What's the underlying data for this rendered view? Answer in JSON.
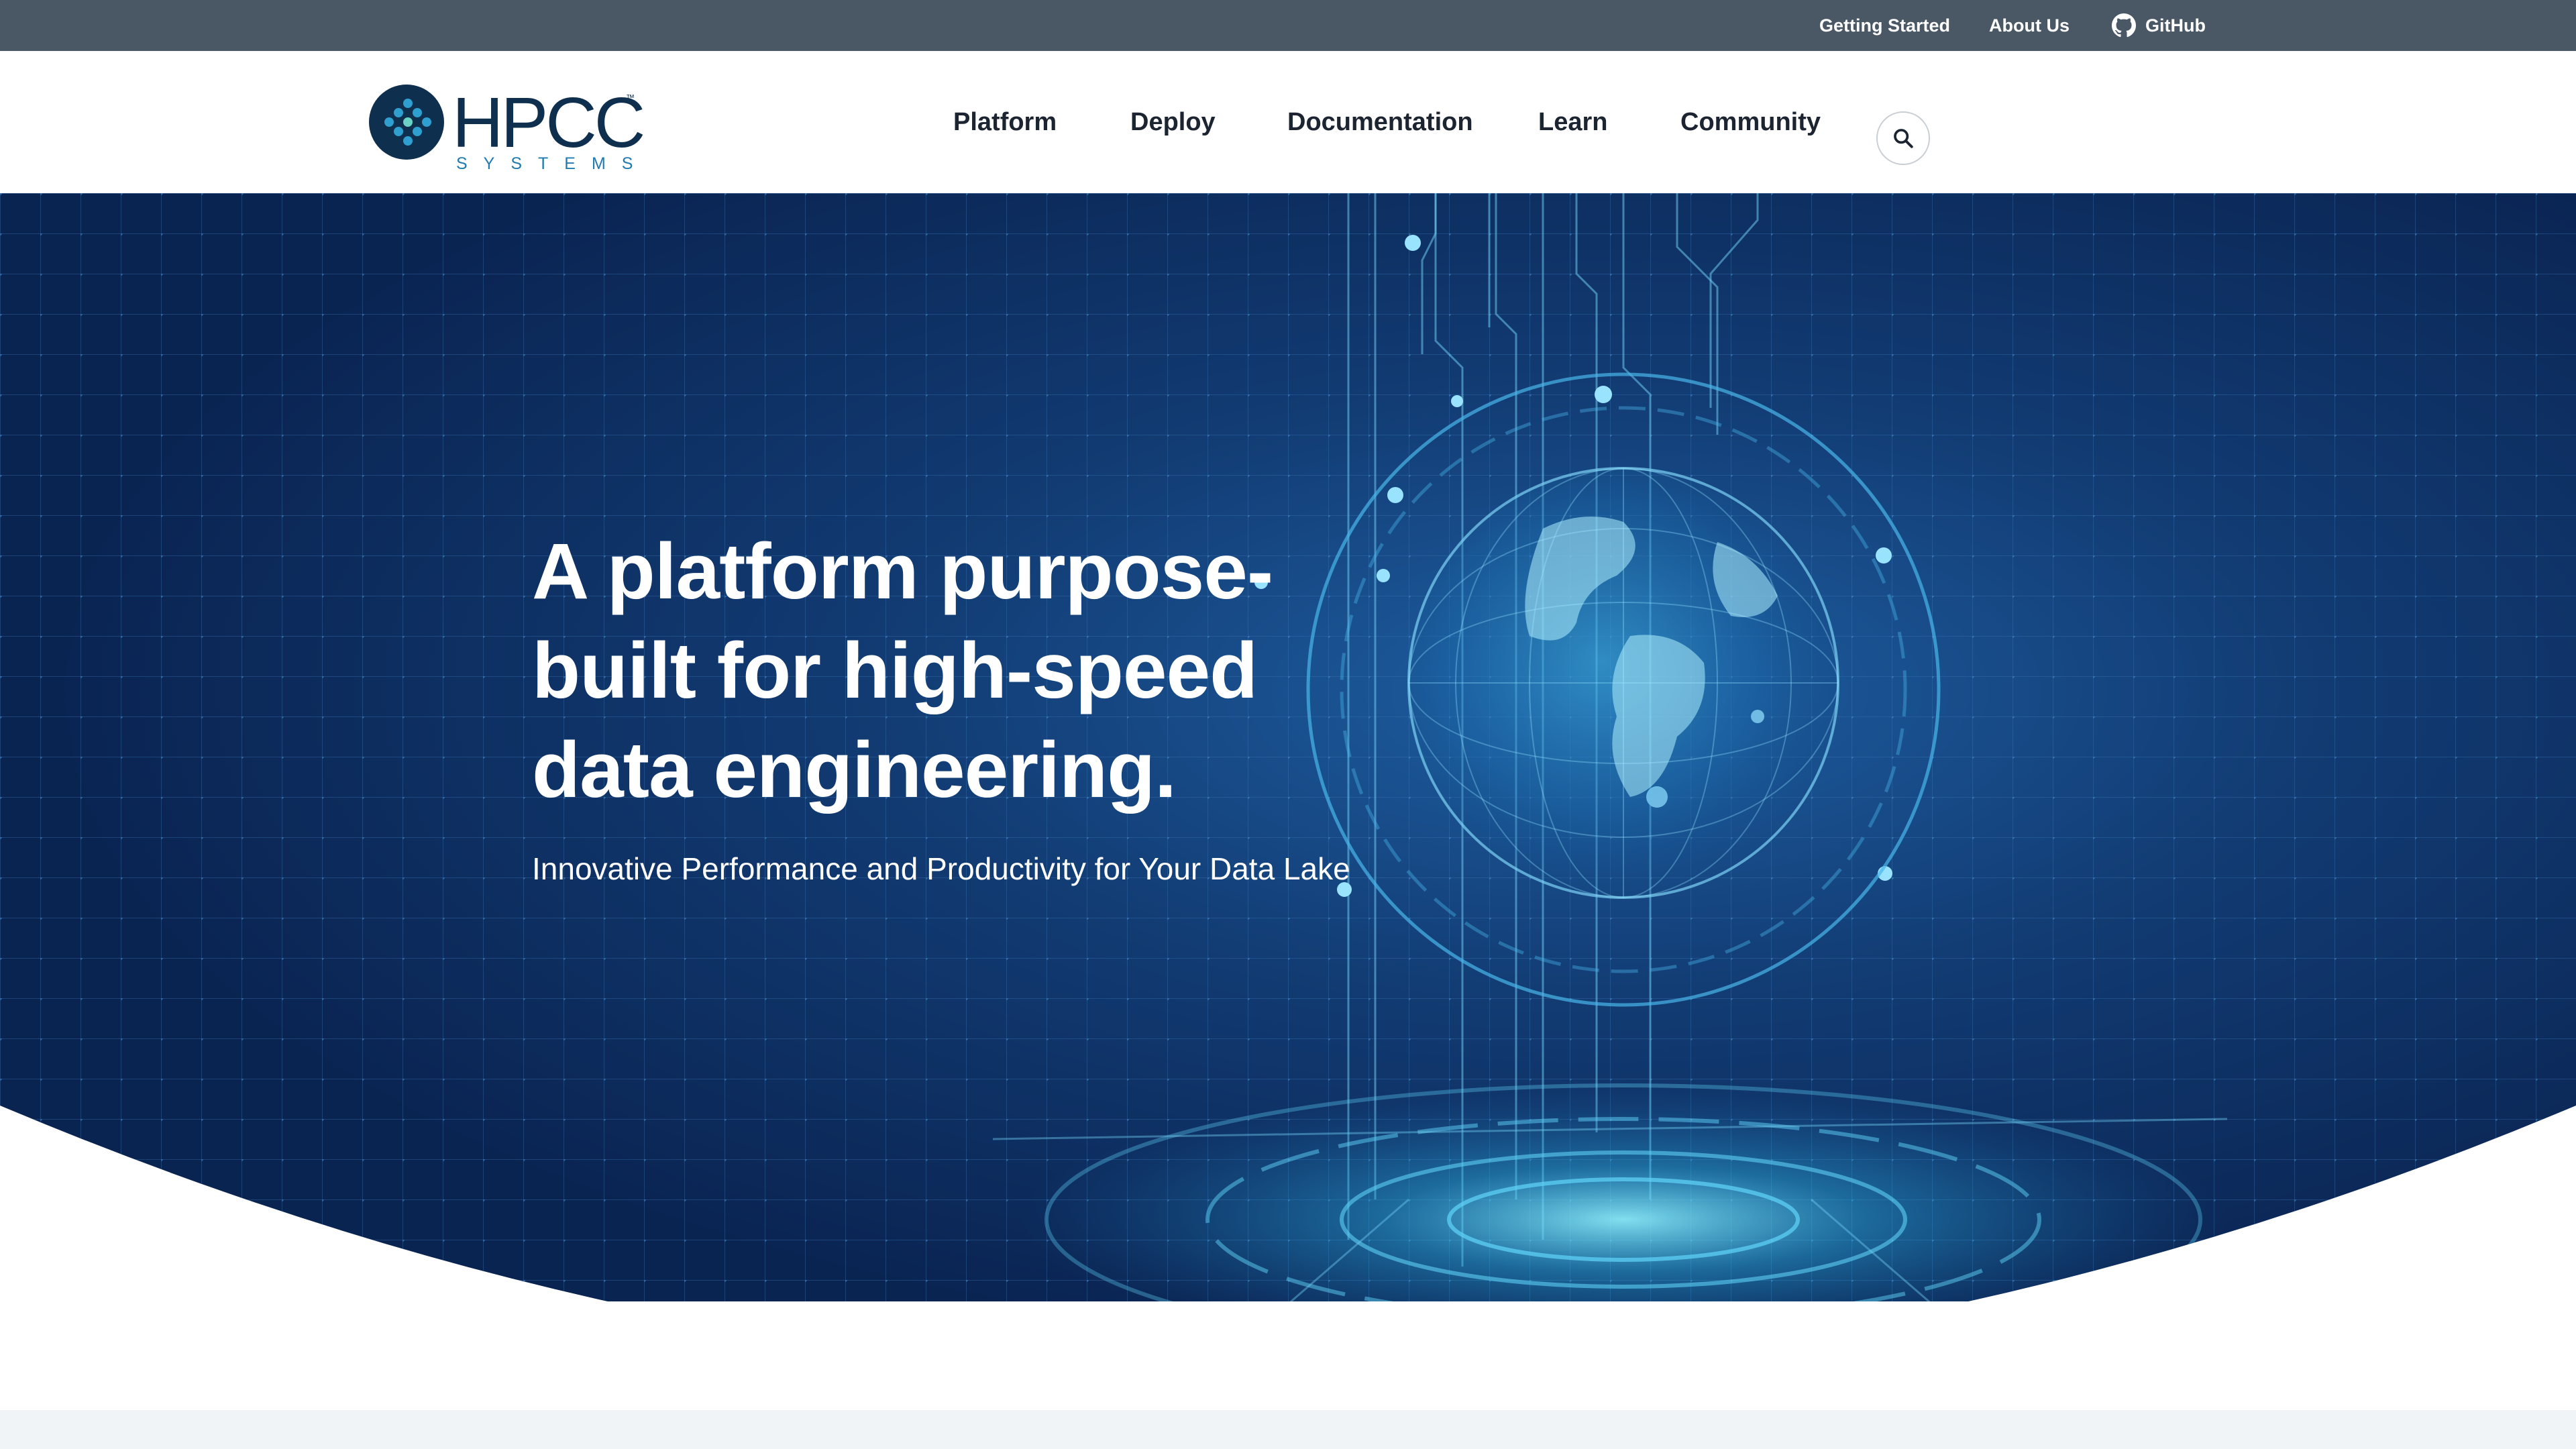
{
  "utility_nav": {
    "getting_started": "Getting Started",
    "about_us": "About Us",
    "github": "GitHub",
    "github_icon": "github-icon"
  },
  "logo": {
    "wordmark": "HPCC",
    "tm": "™",
    "subtitle": "SYSTEMS"
  },
  "main_nav": {
    "items": [
      "Platform",
      "Deploy",
      "Documentation",
      "Learn",
      "Community"
    ],
    "search_icon": "search-icon"
  },
  "hero": {
    "title": "A platform purpose-built for high-speed data engineering.",
    "subtitle": "Innovative Performance and Productivity for Your Data Lake"
  },
  "colors": {
    "utility_bar": "#4a5866",
    "hero_dark": "#0b2a55",
    "hero_glow": "#2fb4e6",
    "logo_navy": "#0f2f4e",
    "logo_teal": "#1f7ab0"
  }
}
